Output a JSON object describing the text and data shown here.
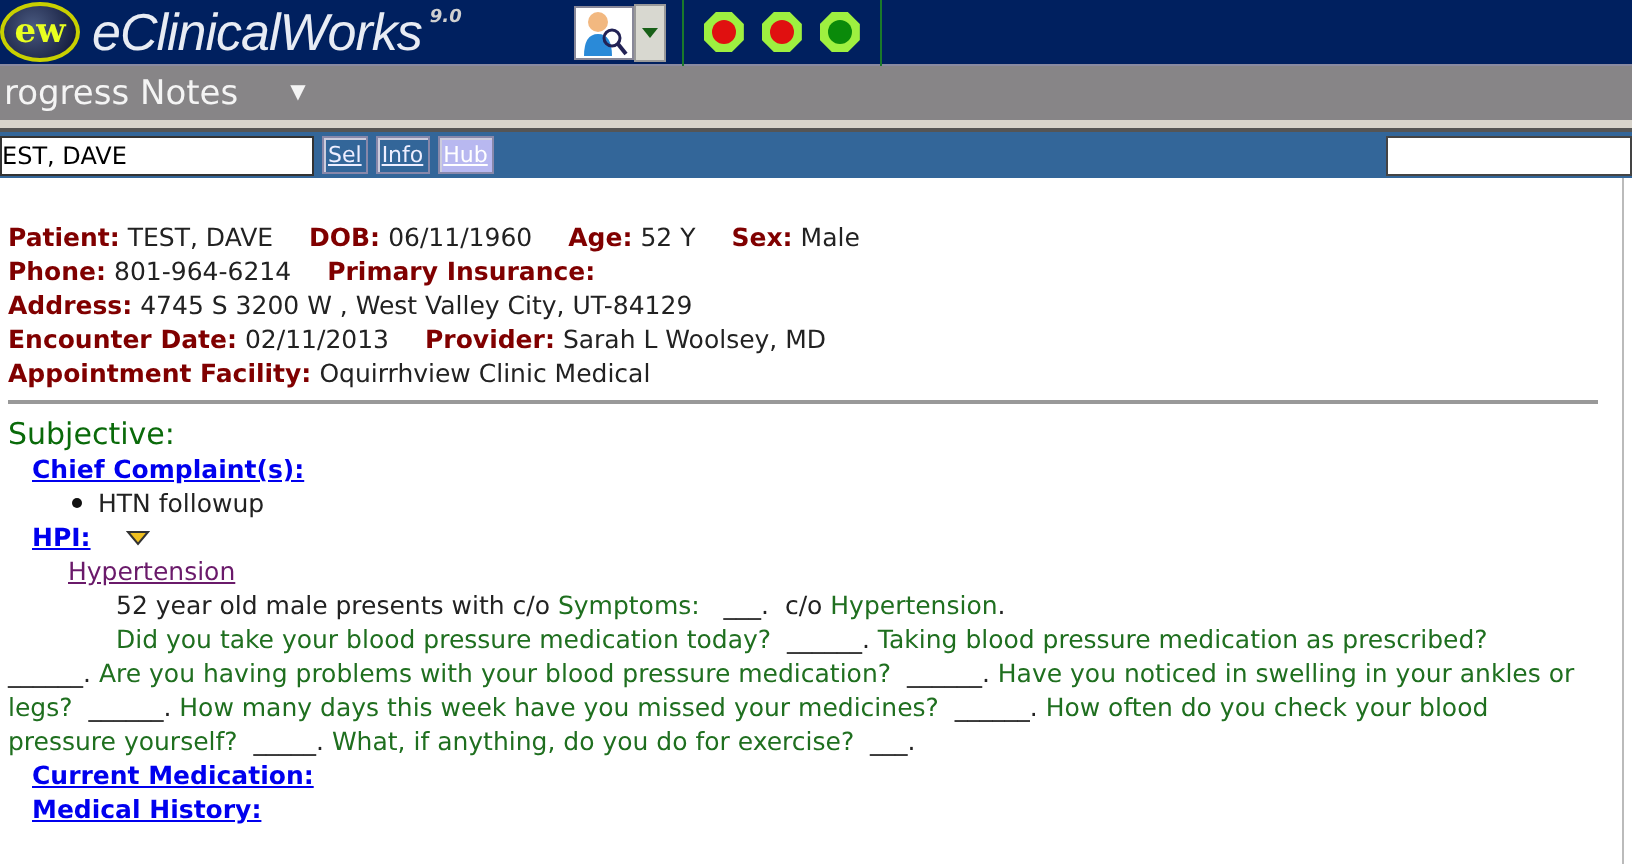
{
  "app": {
    "logo": "ew",
    "title": "eClinicalWorks",
    "version": "9.0",
    "lights": [
      {
        "color": "#e01010"
      },
      {
        "color": "#e01010"
      },
      {
        "color": "#0a8a0a"
      }
    ]
  },
  "module_bar": {
    "title": "rogress Notes",
    "caret": "▼"
  },
  "patient_bar": {
    "patient_value": "EST, DAVE",
    "buttons": [
      {
        "label": "Sel",
        "selected": false
      },
      {
        "label": "Info",
        "selected": false
      },
      {
        "label": "Hub",
        "selected": true
      }
    ]
  },
  "header": [
    [
      {
        "label": "Patient:",
        "value": "TEST, DAVE"
      },
      {
        "label": "DOB:",
        "value": "06/11/1960"
      },
      {
        "label": "Age:",
        "value": "52 Y"
      },
      {
        "label": "Sex:",
        "value": "Male"
      }
    ],
    [
      {
        "label": "Phone:",
        "value": "801-964-6214"
      },
      {
        "label": "Primary Insurance:"
      }
    ],
    [
      {
        "label": "Address:",
        "value": "4745 S 3200 W , West Valley City, UT-84129"
      }
    ],
    [
      {
        "label": "Encounter Date:",
        "value": "02/11/2013"
      },
      {
        "label": "Provider:",
        "value": "Sarah L Woolsey, MD"
      }
    ],
    [
      {
        "label": "Appointment Facility:",
        "value": "Oquirrhview Clinic Medical"
      }
    ]
  ],
  "section_title": "Subjective:",
  "chief_complaint": {
    "heading": "Chief Complaint(s):",
    "items": [
      "HTN followup"
    ]
  },
  "hpi": {
    "heading": "HPI:",
    "expanded": true,
    "topic": "Hypertension",
    "paragraphs": [
      [
        {
          "kind": "plain",
          "text": "52 year old male presents with c/o "
        },
        {
          "kind": "prompt",
          "text": "Symptoms: "
        },
        {
          "kind": "plain",
          "text": "  ___.  c/o "
        },
        {
          "kind": "prompt",
          "text": "Hypertension"
        },
        {
          "kind": "plain",
          "text": "."
        }
      ],
      [
        {
          "kind": "prompt",
          "text": "Did you take your blood pressure medication today? "
        },
        {
          "kind": "plain",
          "text": " ______. "
        },
        {
          "kind": "prompt",
          "text": "Taking blood pressure medication as prescribed? "
        },
        {
          "kind": "plain",
          "text": " ______. "
        },
        {
          "kind": "prompt",
          "text": "Are you having problems with your blood pressure medication? "
        },
        {
          "kind": "plain",
          "text": " ______. "
        },
        {
          "kind": "prompt",
          "text": "Have you noticed in swelling in your ankles or legs? "
        },
        {
          "kind": "plain",
          "text": " ______. "
        },
        {
          "kind": "prompt",
          "text": "How many days this week have you missed your medicines? "
        },
        {
          "kind": "plain",
          "text": " ______. "
        },
        {
          "kind": "prompt",
          "text": "How often do you check your blood pressure yourself? "
        },
        {
          "kind": "plain",
          "text": " _____. "
        },
        {
          "kind": "prompt",
          "text": "What, if anything, do you do for exercise? "
        },
        {
          "kind": "plain",
          "text": " ___."
        }
      ]
    ]
  },
  "more_sections": [
    "Current Medication:",
    "Medical History:"
  ]
}
